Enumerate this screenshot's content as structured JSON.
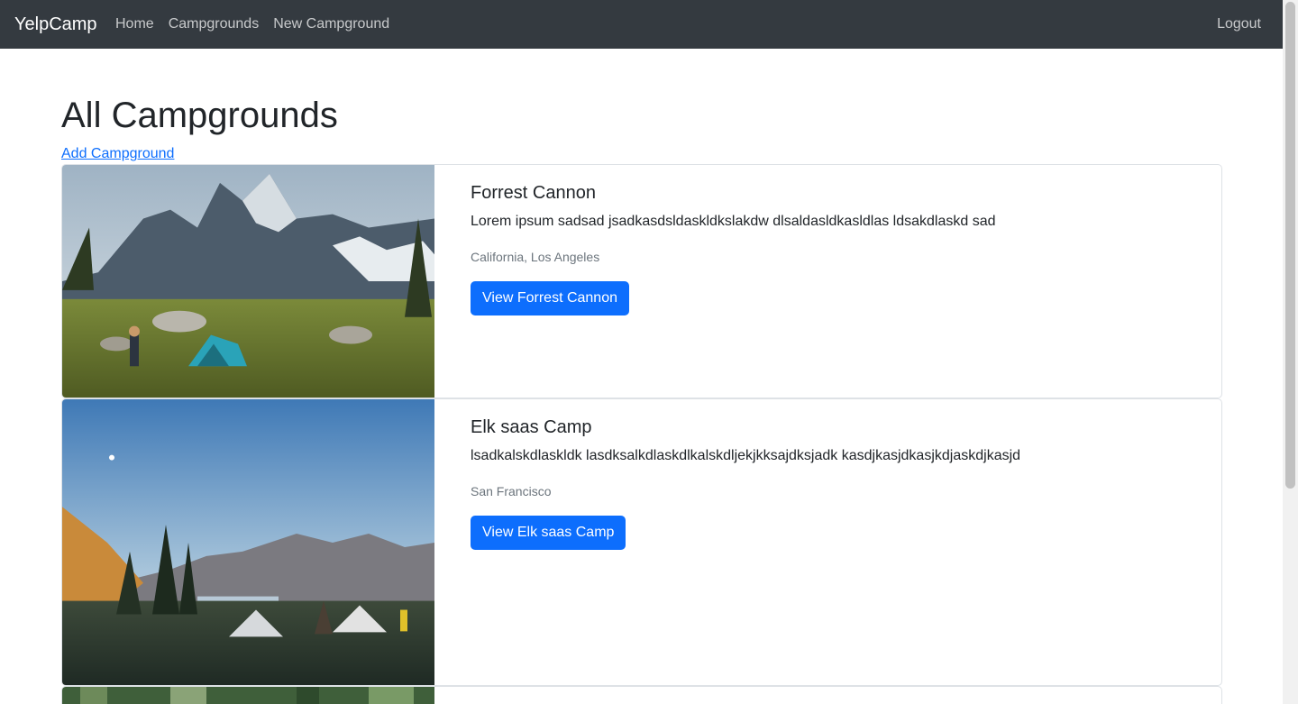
{
  "navbar": {
    "brand": "YelpCamp",
    "links": [
      "Home",
      "Campgrounds",
      "New Campground"
    ],
    "logout": "Logout"
  },
  "main": {
    "title": "All Campgrounds",
    "add_link": "Add Campground",
    "campgrounds": [
      {
        "title": "Forrest Cannon",
        "description": "Lorem ipsum sadsad jsadkasdsldaskldkslakdw dlsaldasldkasldlas ldsakdlaskd sad",
        "location": "California, Los Angeles",
        "button": "View Forrest Cannon"
      },
      {
        "title": "Elk saas Camp",
        "description": "lsadkalskdlaskldk lasdksalkdlaskdlkalskdljekjkksajdksjadk kasdjkasjdkasjkdjaskdjkasjd",
        "location": "San Francisco",
        "button": "View Elk saas Camp"
      }
    ]
  },
  "colors": {
    "navbar_bg": "#343a40",
    "primary": "#0d6efd",
    "muted": "#6c757d"
  }
}
